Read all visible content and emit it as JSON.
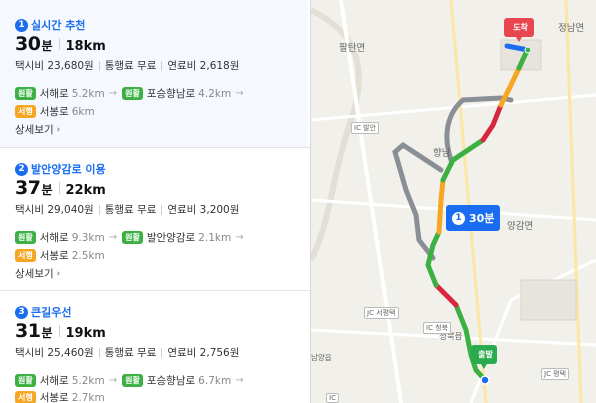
{
  "routes": [
    {
      "index": "1",
      "title": "실시간 추천",
      "minutes": "30",
      "min_unit": "분",
      "distance": "18km",
      "taxi": "택시비 23,680원",
      "toll": "통행료 무료",
      "fuel": "연료비 2,618원",
      "roads": [
        {
          "badge": "원활",
          "badge_color": "green",
          "name": "서해로",
          "dist": "5.2km"
        },
        {
          "badge": "원활",
          "badge_color": "green",
          "name": "포승향남로",
          "dist": "4.2km"
        },
        {
          "badge": "서행",
          "badge_color": "orange",
          "name": "서봉로",
          "dist": "6km"
        }
      ],
      "detail": "상세보기"
    },
    {
      "index": "2",
      "title": "발안양감로 이용",
      "minutes": "37",
      "min_unit": "분",
      "distance": "22km",
      "taxi": "택시비 29,040원",
      "toll": "통행료 무료",
      "fuel": "연료비 3,200원",
      "roads": [
        {
          "badge": "원활",
          "badge_color": "green",
          "name": "서해로",
          "dist": "9.3km"
        },
        {
          "badge": "원활",
          "badge_color": "green",
          "name": "발안양감로",
          "dist": "2.1km"
        },
        {
          "badge": "서행",
          "badge_color": "orange",
          "name": "서봉로",
          "dist": "2.5km"
        }
      ],
      "detail": "상세보기"
    },
    {
      "index": "3",
      "title": "큰길우선",
      "minutes": "31",
      "min_unit": "분",
      "distance": "19km",
      "taxi": "택시비 25,460원",
      "toll": "통행료 무료",
      "fuel": "연료비 2,756원",
      "roads": [
        {
          "badge": "원활",
          "badge_color": "green",
          "name": "서해로",
          "dist": "5.2km"
        },
        {
          "badge": "원활",
          "badge_color": "green",
          "name": "포승향남로",
          "dist": "6.7km"
        },
        {
          "badge": "서행",
          "badge_color": "orange",
          "name": "서봉로",
          "dist": "2.7km"
        }
      ]
    }
  ],
  "map": {
    "labels": {
      "paltan": "팔탄면",
      "jeongnam": "정남면",
      "yanggam": "양감면",
      "hyangnam": "향남",
      "cheongbuk": "청북읍",
      "namyang": "남양읍"
    },
    "ic_labels": {
      "balan": "IC 발안",
      "seopyeongtaek": "JC 서평택",
      "cheongbuk": "IC 청북",
      "pyeongtaek": "JC 평택",
      "palgok": "IC"
    },
    "callout": {
      "index": "1",
      "time": "30분"
    },
    "destination": "도착",
    "origin": "출발"
  },
  "colors": {
    "accent": "#1a6df0",
    "smooth": "#3cb043",
    "slow": "#f5a623",
    "jam": "#d7263d",
    "alt_route": "#8a8f96"
  }
}
